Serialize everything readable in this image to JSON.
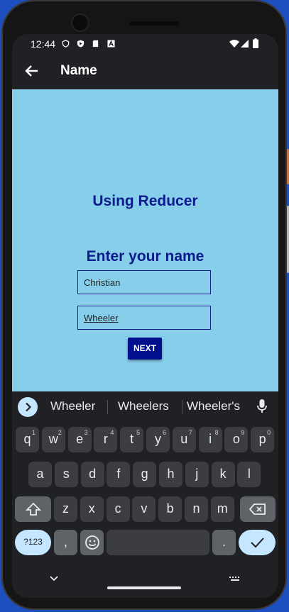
{
  "status": {
    "time": "12:44"
  },
  "appbar": {
    "title": "Name"
  },
  "content": {
    "heading": "Using Reducer",
    "prompt": "Enter your name",
    "first_name": "Christian",
    "last_name": "Wheeler",
    "next_label": "NEXT",
    "background": "#87ceeb",
    "accent": "#0d1a8c"
  },
  "keyboard": {
    "suggestions": [
      "Wheeler",
      "Wheelers",
      "Wheeler's"
    ],
    "row1": [
      {
        "k": "q",
        "n": "1"
      },
      {
        "k": "w",
        "n": "2"
      },
      {
        "k": "e",
        "n": "3"
      },
      {
        "k": "r",
        "n": "4"
      },
      {
        "k": "t",
        "n": "5"
      },
      {
        "k": "y",
        "n": "6"
      },
      {
        "k": "u",
        "n": "7"
      },
      {
        "k": "i",
        "n": "8"
      },
      {
        "k": "o",
        "n": "9"
      },
      {
        "k": "p",
        "n": "0"
      }
    ],
    "row2": [
      "a",
      "s",
      "d",
      "f",
      "g",
      "h",
      "j",
      "k",
      "l"
    ],
    "row3": [
      "z",
      "x",
      "c",
      "v",
      "b",
      "n",
      "m"
    ],
    "sym_label": "?123",
    "comma": ",",
    "period": "."
  }
}
